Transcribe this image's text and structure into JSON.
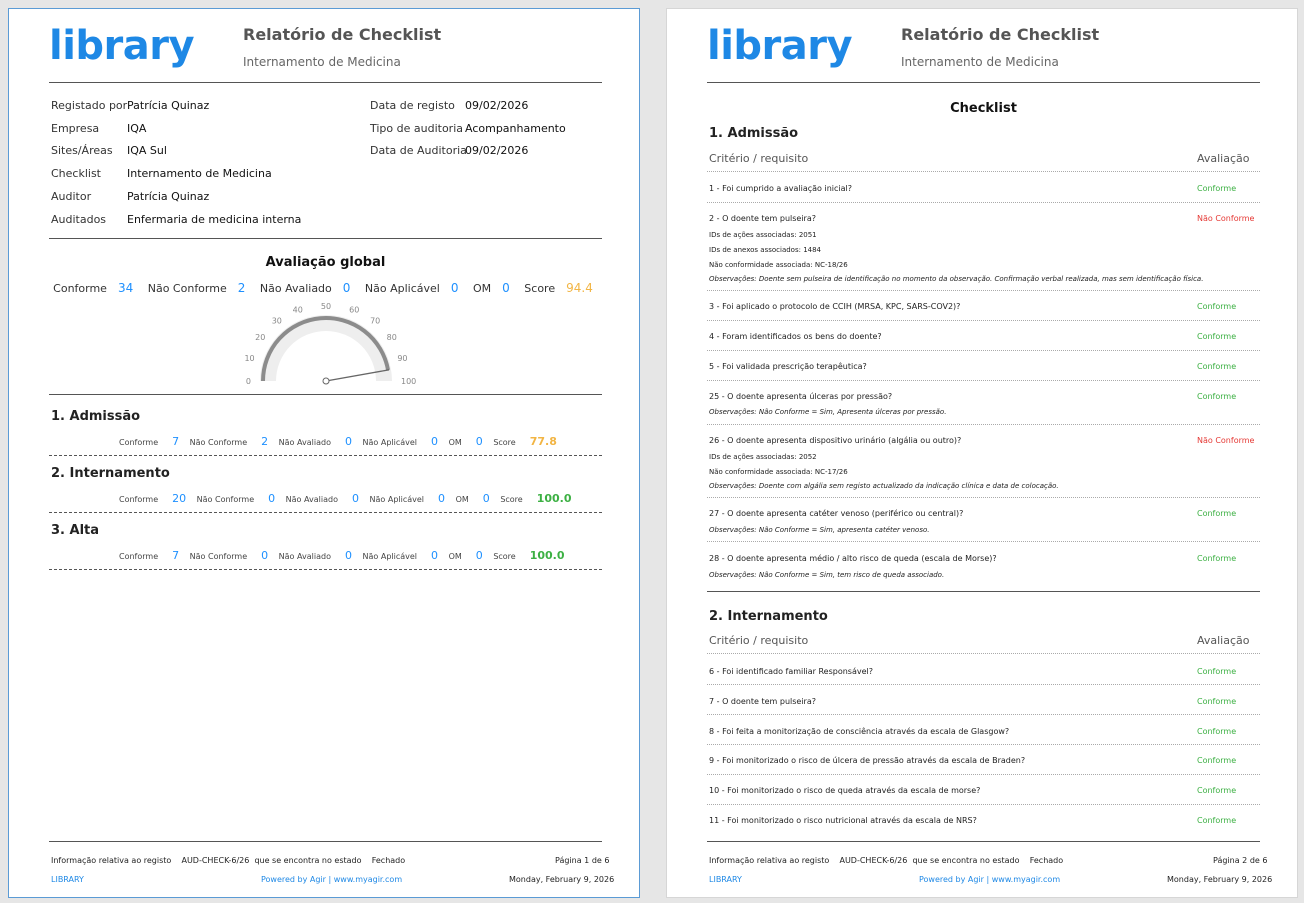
{
  "common": {
    "logo_text": "library",
    "report_title": "Relatório de Checklist",
    "report_subtitle": "Internamento de Medicina",
    "footer": {
      "info_prefix": "Informação relativa ao registo",
      "record_id": "AUD-CHECK-6/26",
      "info_mid": "que se encontra no estado",
      "state": "Fechado",
      "brand": "LIBRARY",
      "powered": "Powered by Agir | www.myagir.com",
      "date": "Monday, February 9, 2026"
    }
  },
  "page1": {
    "page_label": "Página 1 de 6",
    "meta_left": [
      {
        "label": "Registado por",
        "value": "Patrícia Quinaz"
      },
      {
        "label": "Empresa",
        "value": "IQA"
      },
      {
        "label": "Sites/Áreas",
        "value": "IQA Sul"
      },
      {
        "label": "Checklist",
        "value": "Internamento de Medicina"
      },
      {
        "label": "Auditor",
        "value": "Patrícia Quinaz"
      },
      {
        "label": "Auditados",
        "value": "Enfermaria de medicina interna"
      }
    ],
    "meta_right": [
      {
        "label": "Data de registo",
        "value": "09/02/2026"
      },
      {
        "label": "Tipo de auditoria",
        "value": "Acompanhamento"
      },
      {
        "label": "Data de Auditoria",
        "value": "09/02/2026"
      }
    ],
    "global_title": "Avaliação global",
    "global": {
      "conforme_label": "Conforme",
      "conforme": "34",
      "nao_conforme_label": "Não Conforme",
      "nao_conforme": "2",
      "nao_avaliado_label": "Não Avaliado",
      "nao_avaliado": "0",
      "nao_aplicavel_label": "Não Aplicável",
      "nao_aplicavel": "0",
      "om_label": "OM",
      "om": "0",
      "score_label": "Score",
      "score": "94.4"
    },
    "gauge": {
      "ticks": [
        "0",
        "10",
        "20",
        "30",
        "40",
        "50",
        "60",
        "70",
        "80",
        "90",
        "100"
      ],
      "value": 94.4,
      "min": 0,
      "max": 100
    },
    "sections": [
      {
        "title": "1. Admissão",
        "conforme": "7",
        "nao_conforme": "2",
        "nao_avaliado": "0",
        "nao_aplicavel": "0",
        "om": "0",
        "score": "77.8",
        "score_color": "#f2b544"
      },
      {
        "title": "2. Internamento",
        "conforme": "20",
        "nao_conforme": "0",
        "nao_avaliado": "0",
        "nao_aplicavel": "0",
        "om": "0",
        "score": "100.0",
        "score_color": "#3cb043"
      },
      {
        "title": "3. Alta",
        "conforme": "7",
        "nao_conforme": "0",
        "nao_avaliado": "0",
        "nao_aplicavel": "0",
        "om": "0",
        "score": "100.0",
        "score_color": "#3cb043"
      }
    ],
    "stat_labels": {
      "conforme": "Conforme",
      "nao_conforme": "Não Conforme",
      "nao_avaliado": "Não Avaliado",
      "nao_aplicavel": "Não Aplicável",
      "om": "OM",
      "score": "Score"
    }
  },
  "page2": {
    "page_label": "Página 2 de 6",
    "checklist_title": "Checklist",
    "col_criterio": "Critério / requisito",
    "col_avaliacao": "Avaliação",
    "section1_title": "1. Admissão",
    "section2_title": "2. Internamento",
    "items": [
      {
        "text": "1 - Foi cumprido a avaliação inicial?",
        "result": "Conforme"
      },
      {
        "text": "2 - O doente tem pulseira?",
        "result": "Não Conforme",
        "details": [
          "IDs de ações associadas: 2051",
          "IDs de anexos associados: 1484",
          "Não conformidade associada: NC-18/26"
        ],
        "obs": "Observações: Doente sem pulseira de identificação no momento da observação. Confirmação verbal realizada, mas sem identificação física."
      },
      {
        "text": "3 - Foi aplicado o protocolo de CCIH (MRSA, KPC, SARS-COV2)?",
        "result": "Conforme"
      },
      {
        "text": "4 - Foram identificados os bens do doente?",
        "result": "Conforme"
      },
      {
        "text": "5 - Foi validada prescrição terapêutica?",
        "result": "Conforme"
      },
      {
        "text": "25 - O doente apresenta úlceras por pressão?",
        "result": "Conforme",
        "obs": "Observações: Não Conforme = Sim, Apresenta úlceras por pressão."
      },
      {
        "text": "26 - O doente apresenta dispositivo urinário (algália ou outro)?",
        "result": "Não Conforme",
        "details": [
          "IDs de ações associadas: 2052",
          "Não conformidade associada: NC-17/26"
        ],
        "obs": "Observações: Doente com algália sem registo actualizado da indicação clínica e data de colocação."
      },
      {
        "text": "27 - O doente apresenta catéter venoso (periférico ou central)?",
        "result": "Conforme",
        "obs": "Observações: Não Conforme = Sim, apresenta catéter venoso."
      },
      {
        "text": "28 - O doente apresenta médio / alto risco de queda (escala de Morse)?",
        "result": "Conforme",
        "obs": "Observações: Não Conforme = Sim,  tem risco de queda associado."
      },
      {
        "text": "6 - Foi identificado familiar Responsável?",
        "result": "Conforme"
      },
      {
        "text": "7 - O doente tem pulseira?",
        "result": "Conforme"
      },
      {
        "text": "8 - Foi feita a monitorização de consciência através da escala de Glasgow?",
        "result": "Conforme"
      },
      {
        "text": "9 - Foi monitorizado o risco de úlcera de pressão através da escala de Braden?",
        "result": "Conforme"
      },
      {
        "text": "10 - Foi monitorizado o risco de queda através da escala de morse?",
        "result": "Conforme"
      },
      {
        "text": "11 - Foi monitorizado o risco nutricional através da escala de NRS?",
        "result": "Conforme"
      }
    ]
  }
}
